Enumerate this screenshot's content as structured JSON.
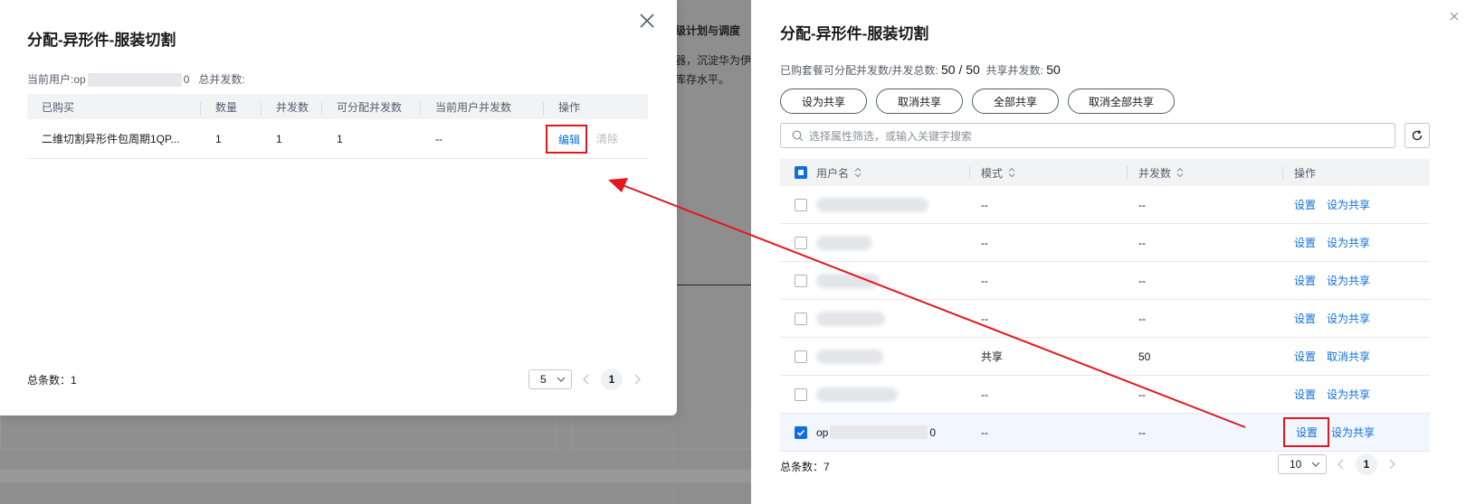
{
  "background": {
    "text1": "级计划与调度",
    "text2": "器，沉淀华为伊",
    "text3": "库存水平。"
  },
  "dialog": {
    "title": "分配-异形件-服装切割",
    "current_user_label": "当前用户:op",
    "current_user_suffix": "0",
    "total_concurrency_label": "总并发数:",
    "columns": [
      "已购买",
      "数量",
      "并发数",
      "可分配并发数",
      "当前用户并发数",
      "操作"
    ],
    "rows": [
      {
        "name": "二维切割异形件包周期1QP...",
        "qty": "1",
        "concurrency": "1",
        "assignable": "1",
        "user_concurrency": "--",
        "edit": "编辑",
        "clear": "清除"
      }
    ],
    "total": "总条数：1",
    "page_size": "5",
    "page": "1"
  },
  "drawer": {
    "title": "分配-异形件-服装切割",
    "quota_label": "已购套餐可分配并发数/并发总数:",
    "quota_value": "50 / 50",
    "shared_label": "共享并发数:",
    "shared_value": "50",
    "buttons": [
      "设为共享",
      "取消共享",
      "全部共享",
      "取消全部共享"
    ],
    "search_placeholder": "选择属性筛选，或输入关键字搜索",
    "columns": {
      "user": "用户名",
      "mode": "模式",
      "concurrency": "并发数",
      "action": "操作"
    },
    "rows": [
      {
        "user": "",
        "mode": "--",
        "concurrency": "--",
        "set": "设置",
        "share": "设为共享",
        "checked": false
      },
      {
        "user": "",
        "mode": "--",
        "concurrency": "--",
        "set": "设置",
        "share": "设为共享",
        "checked": false
      },
      {
        "user": "",
        "mode": "--",
        "concurrency": "--",
        "set": "设置",
        "share": "设为共享",
        "checked": false
      },
      {
        "user": "",
        "mode": "--",
        "concurrency": "--",
        "set": "设置",
        "share": "设为共享",
        "checked": false
      },
      {
        "user": "",
        "mode": "共享",
        "concurrency": "50",
        "set": "设置",
        "share": "取消共享",
        "checked": false
      },
      {
        "user": "",
        "mode": "--",
        "concurrency": "--",
        "set": "设置",
        "share": "设为共享",
        "checked": false
      },
      {
        "user_prefix": "op",
        "user_suffix": "0",
        "mode": "--",
        "concurrency": "--",
        "set": "设置",
        "share": "设为共享",
        "checked": true
      }
    ],
    "total": "总条数：7",
    "page_size": "10",
    "page": "1"
  },
  "colors": {
    "link": "#0e6ede",
    "highlight": "#e5161c",
    "checkbox": "#0e6ede"
  }
}
